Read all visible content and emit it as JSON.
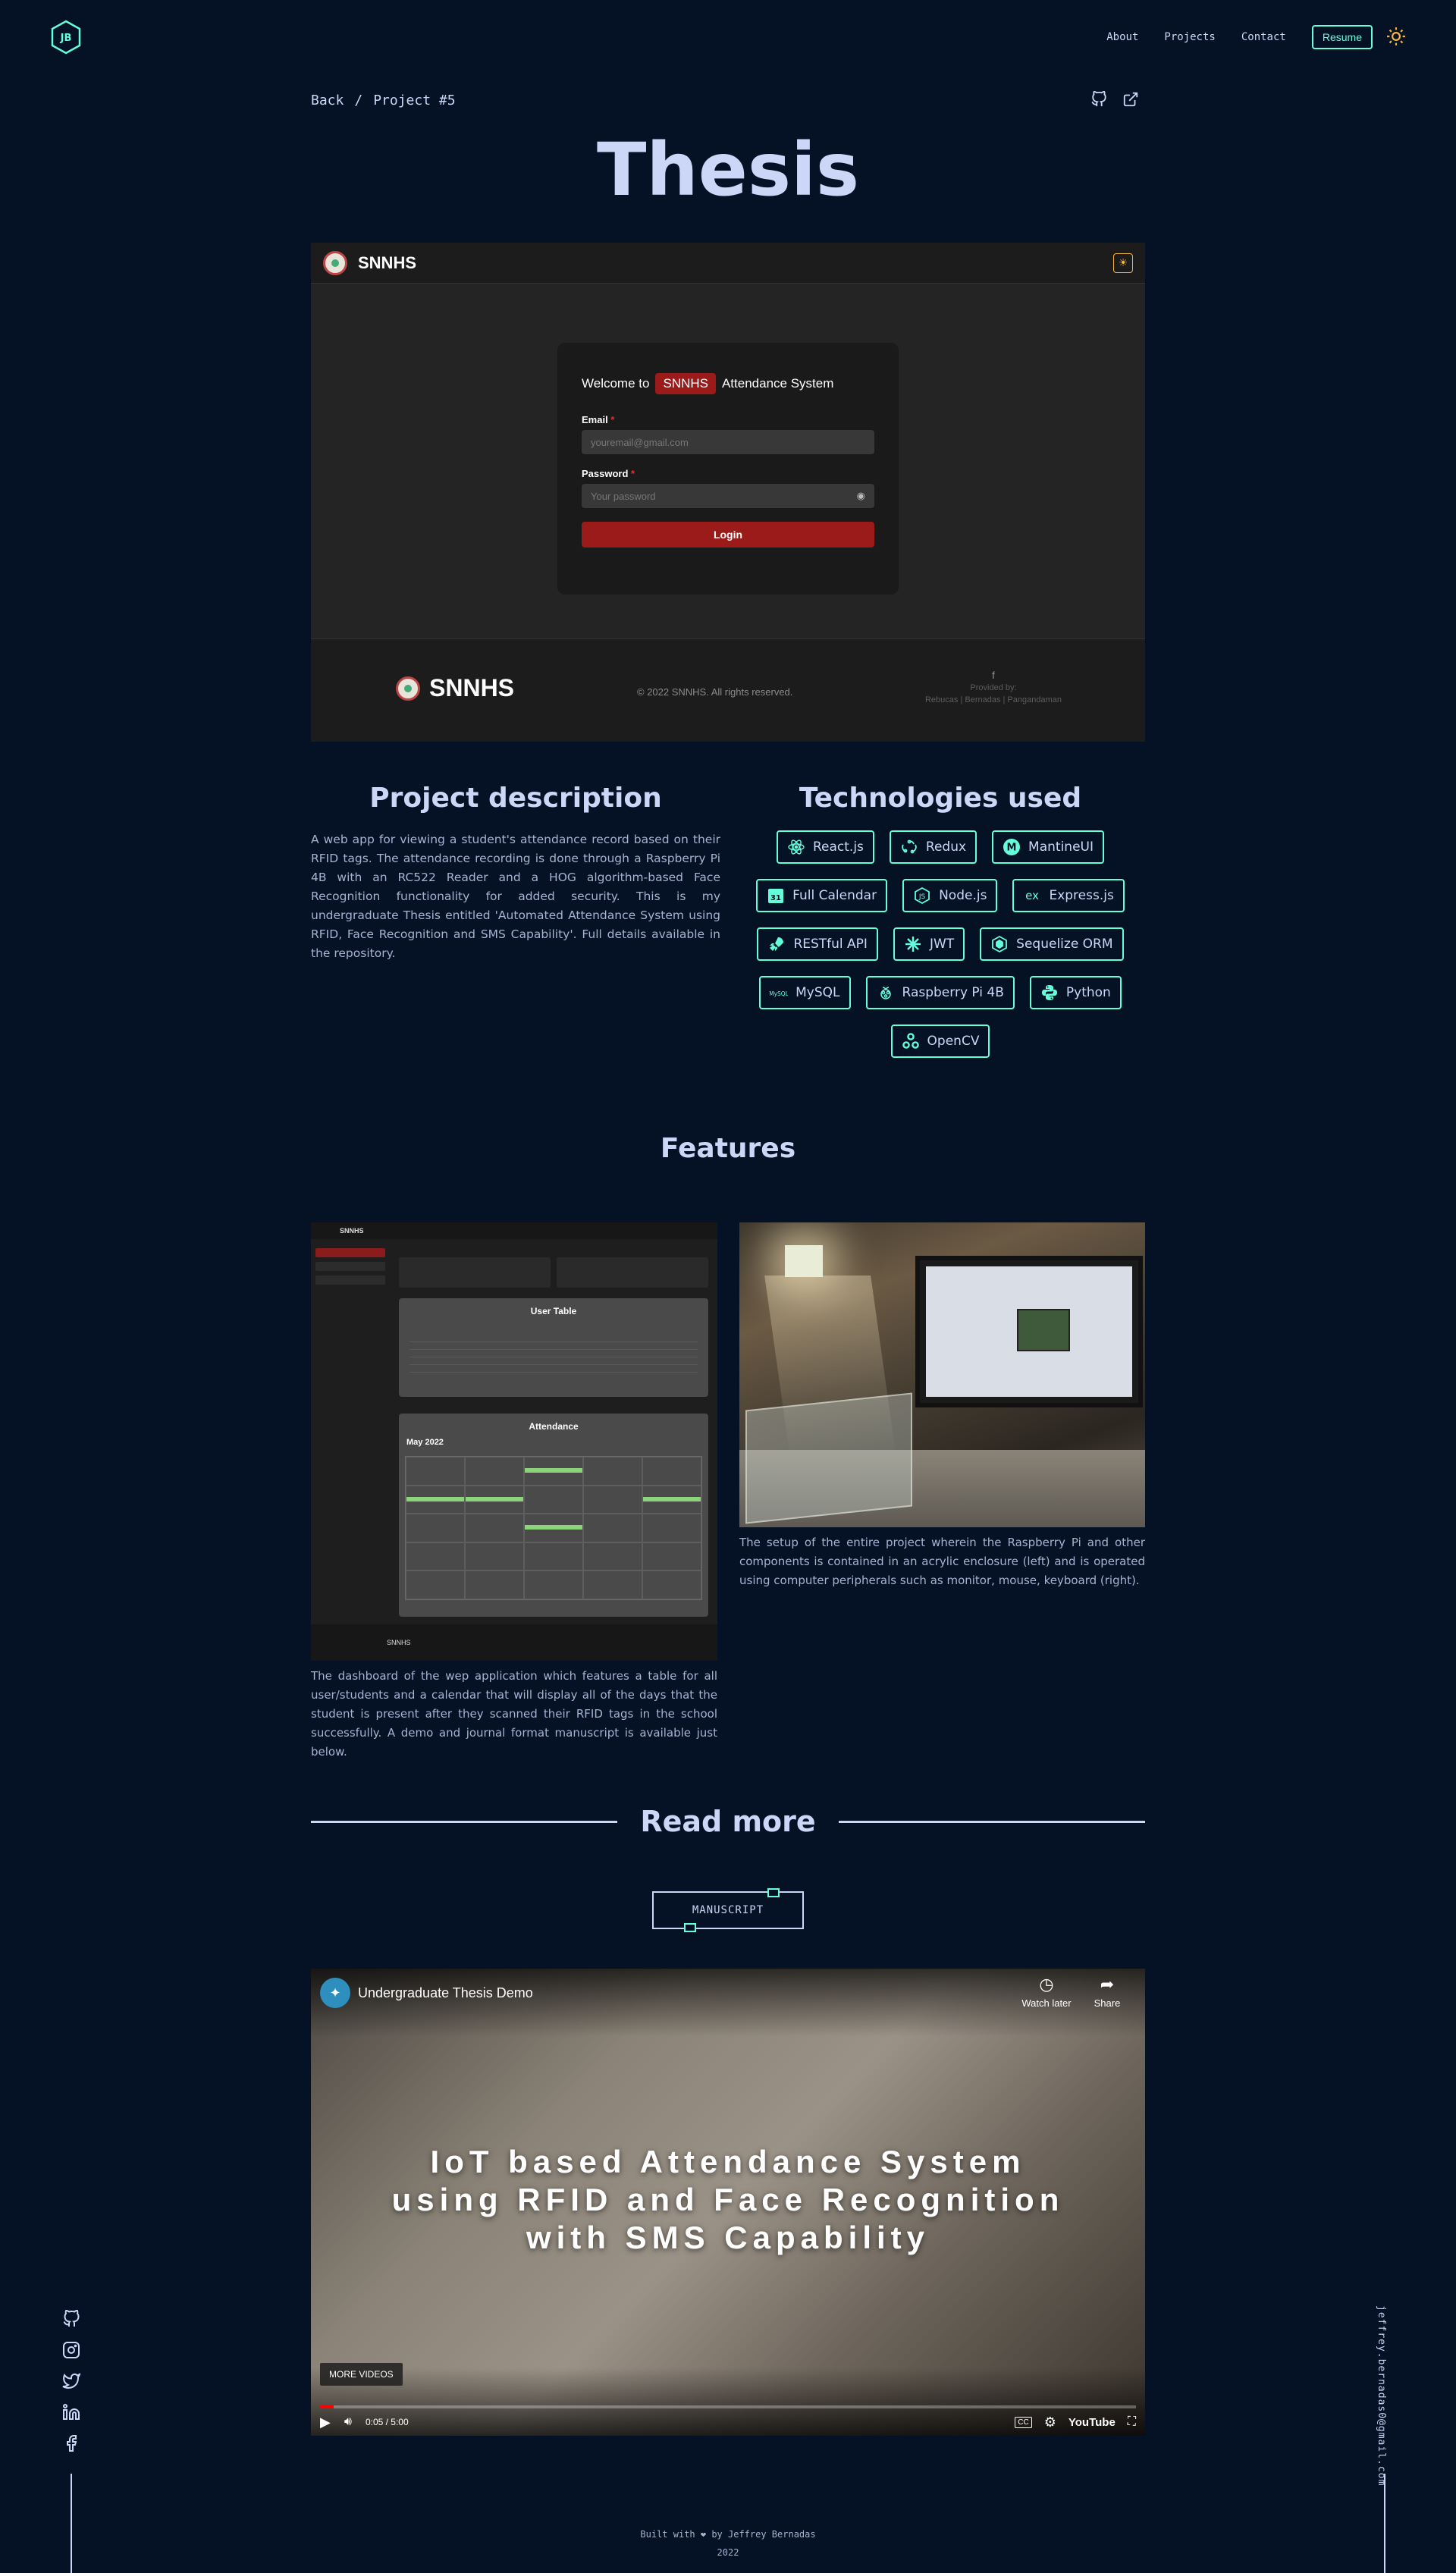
{
  "nav": {
    "logo_text": "JB",
    "links": [
      "About",
      "Projects",
      "Contact"
    ],
    "resume_label": "Resume"
  },
  "breadcrumb": {
    "back": "Back",
    "separator": "/",
    "current": "Project #5"
  },
  "page_title": "Thesis",
  "hero": {
    "brand": "SNNHS",
    "login": {
      "title_pre": "Welcome to",
      "title_badge": "SNNHS",
      "title_post": "Attendance System",
      "email_label": "Email",
      "email_placeholder": "youremail@gmail.com",
      "password_label": "Password",
      "password_placeholder": "Your password",
      "login_button": "Login"
    },
    "footer": {
      "brand": "SNNHS",
      "copyright": "© 2022 SNNHS. All rights reserved.",
      "provided_by": "Provided by:",
      "authors": "Rebucas | Bernadas | Pangandaman"
    }
  },
  "description": {
    "heading": "Project description",
    "text": "A web app for viewing a student's attendance record based on their RFID tags. The attendance recording is done through a Raspberry Pi 4B with an RC522 Reader and a HOG algorithm-based Face Recognition functionality for added security. This is my undergraduate Thesis entitled 'Automated Attendance System using RFID, Face Recognition and SMS Capability'. Full details available in the repository."
  },
  "technologies": {
    "heading": "Technologies used",
    "items": [
      "React.js",
      "Redux",
      "MantineUI",
      "Full Calendar",
      "Node.js",
      "Express.js",
      "RESTful API",
      "JWT",
      "Sequelize ORM",
      "MySQL",
      "Raspberry Pi 4B",
      "Python",
      "OpenCV"
    ]
  },
  "features": {
    "heading": "Features",
    "left": {
      "dash_brand": "SNNHS",
      "user_table": "User Table",
      "attendance": "Attendance",
      "month": "May 2022",
      "caption": "The dashboard of the wep application which features a table for all user/students and a calendar that will display all of the days that the student is present after they scanned their RFID tags in the school successfully. A demo and journal format manuscript is available just below."
    },
    "right": {
      "caption": "The setup of the entire project wherein the Raspberry Pi and other components is contained in an acrylic enclosure (left) and is operated using computer peripherals such as monitor, mouse, keyboard (right)."
    }
  },
  "readmore": {
    "heading": "Read more",
    "manuscript_button": "MANUSCRIPT"
  },
  "video": {
    "title": "Undergraduate Thesis Demo",
    "watch_later": "Watch later",
    "share": "Share",
    "overlay_line1": "IoT based Attendance System",
    "overlay_line2": "using RFID and Face Recognition",
    "overlay_line3": "with SMS Capability",
    "more_videos": "MORE VIDEOS",
    "time": "0:05 / 5:00",
    "progress": 0.017,
    "brand": "YouTube",
    "cc": "CC"
  },
  "email": "jeffrey.bernadas0@gmail.com",
  "footer": {
    "line1": "Built with ❤ by Jeffrey Bernadas",
    "line2": "2022"
  },
  "colors": {
    "background": "#051125",
    "accent": "#64ffda",
    "text": "#ccd6f6",
    "brand_red": "#9b1b1b"
  }
}
